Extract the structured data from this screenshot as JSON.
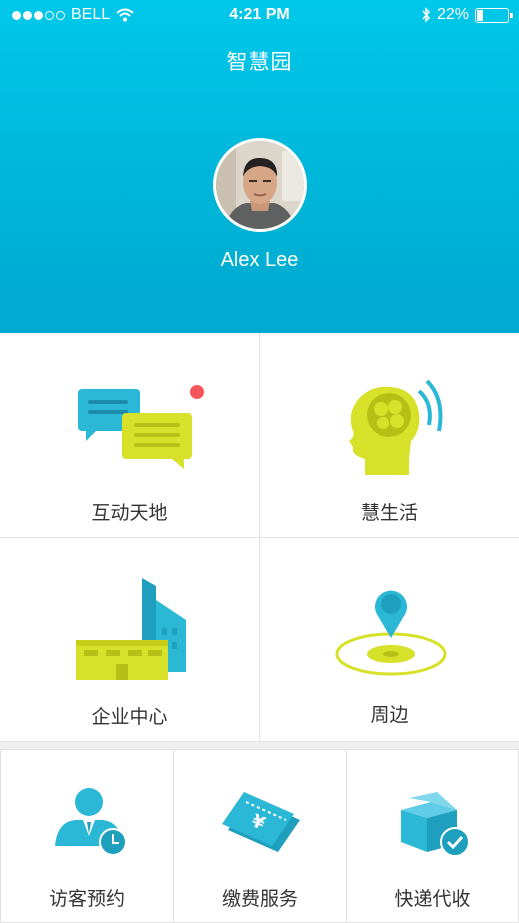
{
  "status_bar": {
    "carrier": "BELL",
    "time": "4:21 PM",
    "battery_percent": "22%",
    "battery_level": 0.22
  },
  "header": {
    "title": "智慧园",
    "user_name": "Alex Lee"
  },
  "tiles": [
    {
      "label": "互动天地",
      "icon": "chat-bubbles-icon",
      "has_notification": true
    },
    {
      "label": "慧生活",
      "icon": "brain-head-icon"
    },
    {
      "label": "企业中心",
      "icon": "buildings-icon"
    },
    {
      "label": "周边",
      "icon": "location-pin-icon"
    }
  ],
  "bottom_tiles": [
    {
      "label": "访客预约",
      "icon": "visitor-clock-icon"
    },
    {
      "label": "缴费服务",
      "icon": "payment-ticket-icon"
    },
    {
      "label": "快递代收",
      "icon": "package-check-icon"
    }
  ],
  "colors": {
    "header_top": "#00c8ea",
    "header_bottom": "#00a9cf",
    "icon_blue": "#2bb8d6",
    "icon_yellow": "#d8e12a",
    "notification": "#f4565a"
  }
}
